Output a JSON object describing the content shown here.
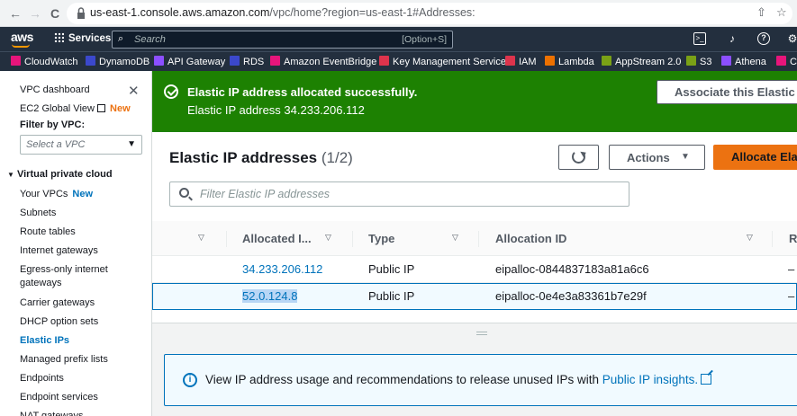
{
  "browser": {
    "url_host": "us-east-1.console.aws.amazon.com",
    "url_path": "/vpc/home?region=us-east-1#Addresses:",
    "back": "←",
    "forward": "→",
    "reload": "C",
    "share": "⇧",
    "star": "☆"
  },
  "aws_nav": {
    "logo": "aws",
    "services": "Services",
    "search_placeholder": "Search",
    "search_shortcut": "[Option+S]",
    "icons": [
      "cloudshell-icon",
      "bell-icon",
      "help-icon",
      "gear-icon"
    ]
  },
  "favorites": [
    {
      "label": "CloudWatch",
      "color": "#e7157b"
    },
    {
      "label": "DynamoDB",
      "color": "#3b48cc"
    },
    {
      "label": "API Gateway",
      "color": "#8c4fff"
    },
    {
      "label": "RDS",
      "color": "#3b48cc"
    },
    {
      "label": "Amazon EventBridge",
      "color": "#e7157b"
    },
    {
      "label": "Key Management Service",
      "color": "#dd344c"
    },
    {
      "label": "IAM",
      "color": "#dd344c"
    },
    {
      "label": "Lambda",
      "color": "#ed7100"
    },
    {
      "label": "AppStream 2.0",
      "color": "#7aa116"
    },
    {
      "label": "S3",
      "color": "#7aa116"
    },
    {
      "label": "Athena",
      "color": "#8c4fff"
    },
    {
      "label": "Cl",
      "color": "#e7157b"
    }
  ],
  "sidebar": {
    "dashboard": "VPC dashboard",
    "global_view": "EC2 Global View",
    "new_badge": "New",
    "filter_label": "Filter by VPC:",
    "vpc_select_placeholder": "Select a VPC",
    "section": "Virtual private cloud",
    "items": [
      {
        "label": "Your VPCs",
        "badge": "New"
      },
      {
        "label": "Subnets"
      },
      {
        "label": "Route tables"
      },
      {
        "label": "Internet gateways"
      },
      {
        "label": "Egress-only internet",
        "label2": "gateways"
      },
      {
        "label": "Carrier gateways"
      },
      {
        "label": "DHCP option sets"
      },
      {
        "label": "Elastic IPs",
        "active": true
      },
      {
        "label": "Managed prefix lists"
      },
      {
        "label": "Endpoints"
      },
      {
        "label": "Endpoint services"
      },
      {
        "label": "NAT gateways"
      }
    ]
  },
  "flash": {
    "title": "Elastic IP address allocated successfully.",
    "message": "Elastic IP address 34.233.206.112",
    "button": "Associate this Elastic IP address"
  },
  "panel": {
    "title": "Elastic IP addresses",
    "count": "(1/2)",
    "actions": "Actions",
    "allocate": "Allocate Elastic IP address",
    "filter_placeholder": "Filter Elastic IP addresses",
    "columns": [
      "Allocated I...",
      "Type",
      "Allocation ID",
      "R"
    ],
    "rows": [
      {
        "ip": "34.233.206.112",
        "type": "Public IP",
        "allocation_id": "eipalloc-0844837183a81a6c6",
        "r": "–",
        "selected": false
      },
      {
        "ip": "52.0.124.8",
        "type": "Public IP",
        "allocation_id": "eipalloc-0e4e3a83361b7e29f",
        "r": "–",
        "selected": true
      }
    ]
  },
  "info": {
    "text": "View IP address usage and recommendations to release unused IPs with",
    "link": "Public IP insights."
  }
}
